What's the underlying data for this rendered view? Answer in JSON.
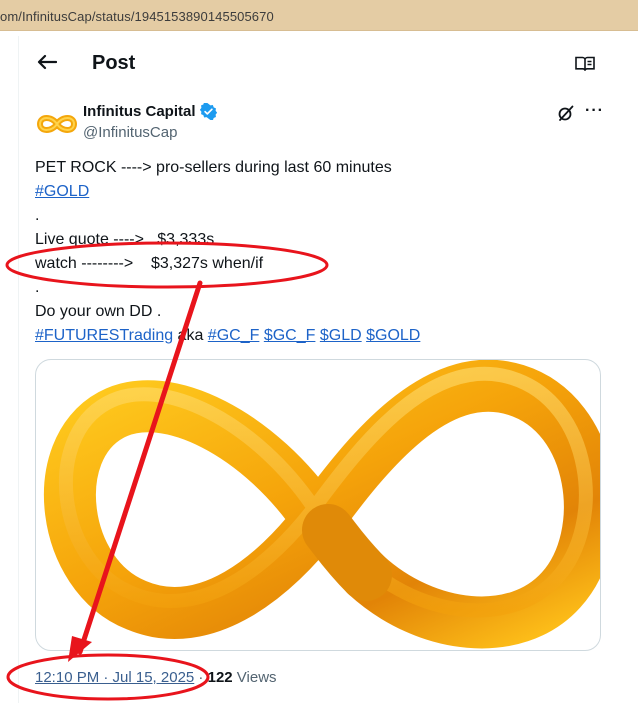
{
  "browser": {
    "url": "om/InfinitusCap/status/1945153890145505670"
  },
  "header": {
    "title": "Post"
  },
  "author": {
    "name": "Infinitus Capital",
    "handle": "@InfinitusCap"
  },
  "post": {
    "line1": "PET ROCK ----> pro-sellers during last 60 minutes",
    "hashtag_gold": "#GOLD",
    "dot1": ".",
    "line_live": "Live quote ---->   $3,333s",
    "line_watch": "watch -------->    $3,327s when/if",
    "dot2": ".",
    "line_dd": "Do your own DD .",
    "tags": {
      "futures": "#FUTURESTrading",
      "aka": " aka ",
      "gcf": "#GC_F",
      "cashgcf": "$GC_F",
      "gld": "$GLD",
      "cashgold": "$GOLD"
    }
  },
  "meta": {
    "timestamp": "12:10 PM · Jul 15, 2025",
    "separator": " · ",
    "views_count": "122",
    "views_label": " Views"
  },
  "colors": {
    "link": "#1d63c8",
    "verified": "#1d9bf0",
    "annotation": "#e8141c",
    "urlbar": "#e4cca4"
  },
  "icons": [
    "back-arrow-icon",
    "reader-icon",
    "verified-badge-icon",
    "grok-icon",
    "more-icon"
  ]
}
